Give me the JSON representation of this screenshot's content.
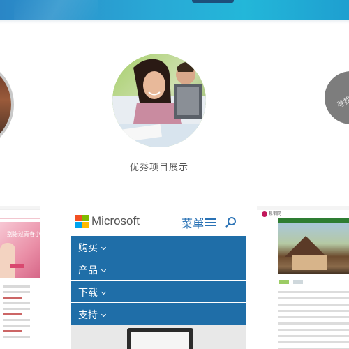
{
  "colors": {
    "banner": "#29a9d6",
    "ms_blue": "#1f6ea8",
    "ms_link": "#2a72b5",
    "caption": "#555555"
  },
  "showcase": {
    "caption": "优秀项目展示",
    "right_circle_label": "寻找"
  },
  "thumb_left": {
    "hero_text": "别错过青春小事"
  },
  "microsoft_card": {
    "brand": "Microsoft",
    "menu_label": "菜单",
    "menu_icon": "hamburger-icon",
    "search_icon": "search-icon",
    "menu_items": [
      {
        "label": "购买"
      },
      {
        "label": "产品"
      },
      {
        "label": "下载"
      },
      {
        "label": "支持"
      }
    ]
  },
  "thumb_right": {
    "logo_text": "易钢网"
  }
}
